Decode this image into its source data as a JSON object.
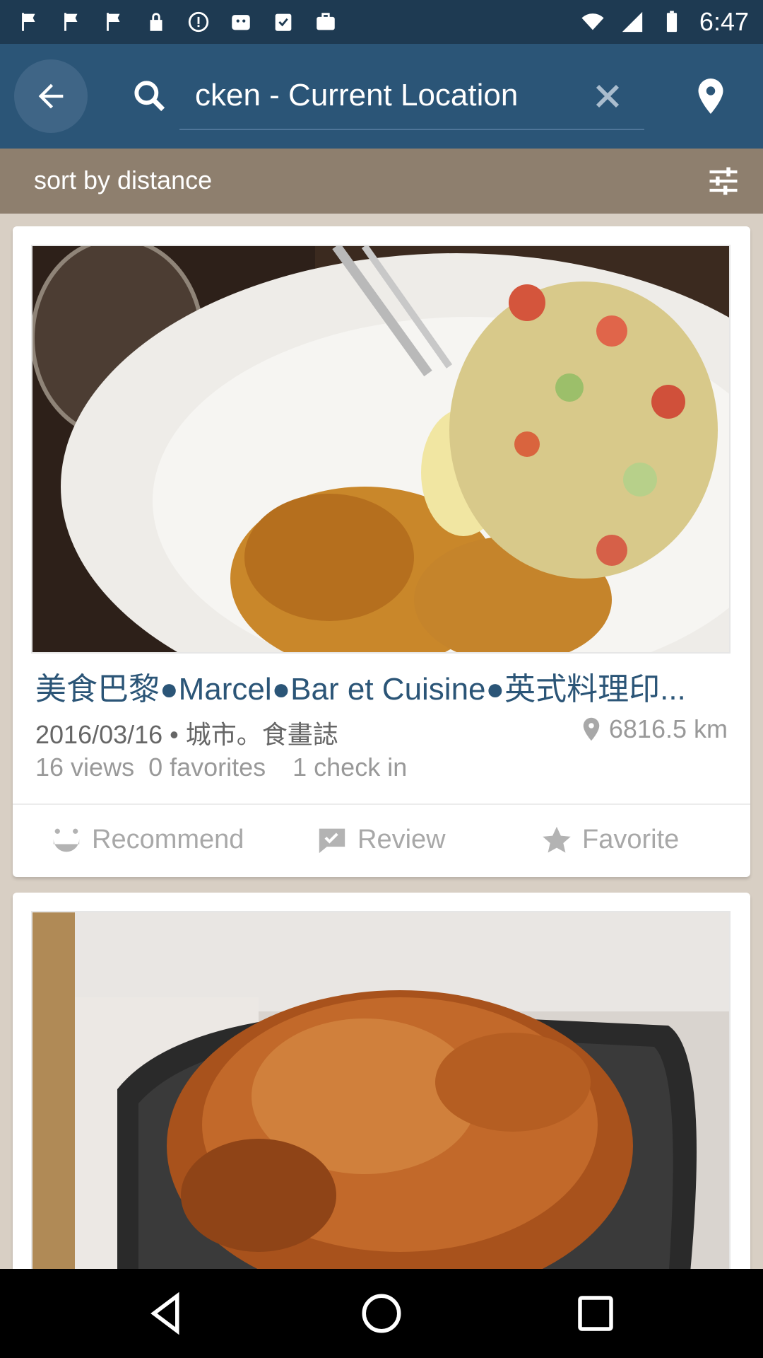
{
  "status_bar": {
    "time": "6:47"
  },
  "app_bar": {
    "search_value": "cken  -  Current Location"
  },
  "sort_bar": {
    "label": "sort by distance"
  },
  "cards": [
    {
      "title": "美食巴黎●Marcel●Bar et Cuisine●英式料理印...",
      "date_source": "2016/03/16 • 城市。食畫誌",
      "distance": "6816.5 km",
      "views": "16 views",
      "favorites": "0 favorites",
      "checkins": "1 check in",
      "actions": {
        "recommend": "Recommend",
        "review": "Review",
        "favorite": "Favorite"
      }
    },
    {
      "title": ""
    }
  ],
  "colors": {
    "status_bar": "#1e3a52",
    "app_bar": "#2b5577",
    "sort_bar": "#8e7f6e",
    "title": "#2b5577",
    "background": "#d8cfc4"
  },
  "icons": {
    "back": "arrow-left-icon",
    "search": "search-icon",
    "clear": "close-icon",
    "location": "location-pin-icon",
    "filter": "tune-sliders-icon",
    "recommend": "smile-icon",
    "review": "check-comment-icon",
    "favorite": "star-icon"
  }
}
